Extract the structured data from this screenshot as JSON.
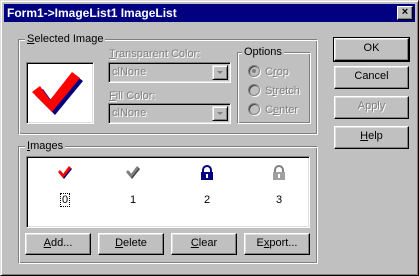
{
  "window": {
    "title": "Form1->ImageList1 ImageList",
    "close_glyph": "×"
  },
  "selected_image": {
    "group_label_prefix": "",
    "group_label_accel": "S",
    "group_label_rest": "elected Image",
    "transparent_color": {
      "label_accel": "T",
      "label_rest": "ransparent Color:",
      "value": "clNone"
    },
    "fill_color": {
      "label_accel": "F",
      "label_rest": "ill Color:",
      "value": "clNone"
    },
    "options": {
      "label": "Options",
      "items": [
        {
          "accel": "",
          "pre": "C",
          "accel_char": "r",
          "post": "op",
          "checked": true
        },
        {
          "pre": "S",
          "accel_char": "t",
          "post": "retch",
          "checked": false
        },
        {
          "pre": "C",
          "accel_char": "e",
          "post": "nter",
          "checked": false
        }
      ]
    }
  },
  "buttons": {
    "ok": "OK",
    "cancel": "Cancel",
    "apply": "Apply",
    "help_accel": "H",
    "help_rest": "elp"
  },
  "images": {
    "group_label_accel": "I",
    "group_label_rest": "mages",
    "items": [
      {
        "caption": "0",
        "icon": "red-check-icon"
      },
      {
        "caption": "1",
        "icon": "gray-check-icon"
      },
      {
        "caption": "2",
        "icon": "navy-padlock-icon"
      },
      {
        "caption": "3",
        "icon": "gray-padlock-icon"
      }
    ],
    "actions": {
      "add_accel": "A",
      "add_rest": "dd...",
      "delete_accel": "D",
      "delete_rest": "elete",
      "clear_accel": "C",
      "clear_rest": "lear",
      "export_pre": "E",
      "export_accel": "x",
      "export_rest": "port..."
    }
  },
  "colors": {
    "titlebar": "#000080",
    "face": "#c0c0c0",
    "check_red": "#ff0000",
    "check_shadow": "#000080",
    "check_gray": "#808080"
  }
}
